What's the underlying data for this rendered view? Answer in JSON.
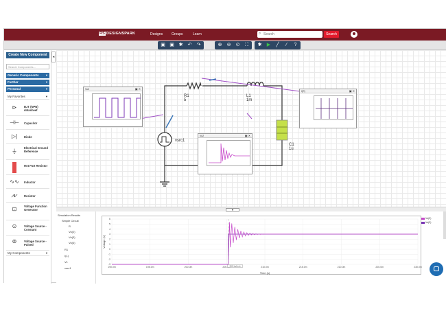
{
  "nav": {
    "logo": "DESIGNSPARK",
    "logo_prefix": "RS",
    "links": [
      "Designs",
      "Groups",
      "Learn"
    ],
    "search_placeholder": "Search",
    "search_button": "Search"
  },
  "toolbar": {
    "icons": [
      "save-icon",
      "save-as-icon",
      "settings-icon",
      "undo-icon",
      "redo-icon",
      "zoom-in-icon",
      "zoom-out-icon",
      "zoom-fit-icon",
      "fullscreen-icon",
      "simulation-settings-icon",
      "run-icon",
      "draw-wire-icon",
      "probe-icon",
      "help-icon"
    ]
  },
  "sidebar": {
    "create_button": "Create New Component",
    "search_placeholder": "Search Components...",
    "categories": [
      "Generic Components",
      "Further",
      "Personal"
    ],
    "favorites_label": "My Favorites",
    "components": [
      {
        "label": "BJT (NPN) datasheet",
        "icon": "npn-transistor-icon"
      },
      {
        "label": "Capacitor",
        "icon": "capacitor-icon"
      },
      {
        "label": "Diode",
        "icon": "diode-icon"
      },
      {
        "label": "Electrical Ground Reference",
        "icon": "ground-icon"
      },
      {
        "label": "Hot Part Resistor",
        "icon": "hot-resistor-icon"
      },
      {
        "label": "Inductor",
        "icon": "inductor-icon"
      },
      {
        "label": "Resistor",
        "icon": "resistor-icon"
      },
      {
        "label": "Voltage Function Generator",
        "icon": "function-generator-icon"
      },
      {
        "label": "Voltage Source - Constant",
        "icon": "constant-source-icon"
      },
      {
        "label": "Voltage Source - Pulsed",
        "icon": "pulsed-source-icon"
      }
    ],
    "my_components": "My Components"
  },
  "schematic": {
    "r1": {
      "name": "R1",
      "value": "5"
    },
    "l1": {
      "name": "L1",
      "value": "1m"
    },
    "c1": {
      "name": "C1",
      "value": "1u"
    },
    "source": {
      "name": "vsrc1"
    },
    "probe_labels": [
      "Vo2",
      "Vo2",
      "I(R)"
    ]
  },
  "results": {
    "tree": [
      "Simulation Results",
      "Simple Circuit",
      "R",
      "Vo(2)",
      "Vo(3)",
      "Vo(4)",
      "R1",
      "I(L)",
      "V1",
      "vsrc1"
    ],
    "x_label": "Time (s)",
    "y_label": "Voltage (V)",
    "legend": [
      {
        "name": "Vo(2)",
        "color": "#c548c9"
      },
      {
        "name": "Vo(3)",
        "color": "#7b36b5"
      }
    ],
    "x_ticks": [
      "190.0m",
      "195.0m",
      "200.0m",
      "205.0m",
      "210.0m",
      "215.0m",
      "220.0m",
      "225.0m",
      "230.0m"
    ],
    "y_ticks": [
      "6",
      "5",
      "4",
      "3",
      "2",
      "1",
      "0",
      "-1",
      "-2",
      "-3"
    ],
    "cursor_label": "200.1µ/(ms)"
  },
  "colors": {
    "nav": "#7b1a24",
    "accent": "#e21b2d",
    "toolbar": "#2d4663",
    "trace": "#c548c9",
    "cap": "#c5e04a"
  }
}
